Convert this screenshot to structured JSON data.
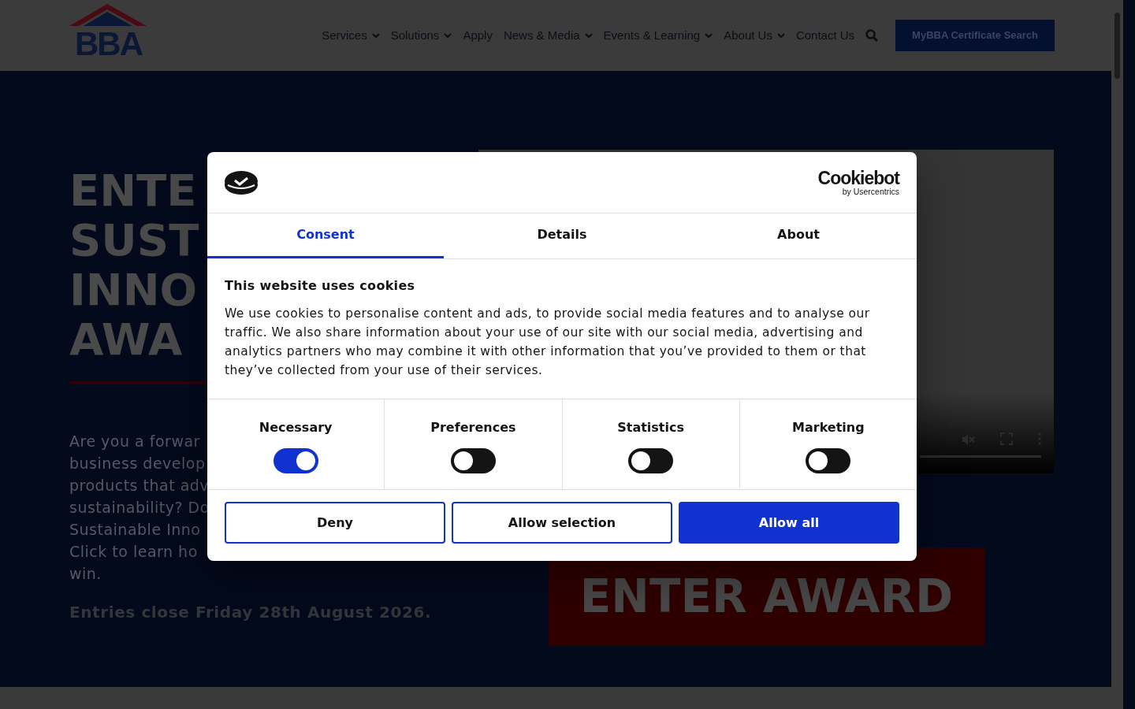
{
  "header": {
    "logo": "BBA",
    "nav": [
      {
        "label": "Services",
        "dropdown": true
      },
      {
        "label": "Solutions",
        "dropdown": true
      },
      {
        "label": "Apply",
        "dropdown": false
      },
      {
        "label": "News & Media",
        "dropdown": true
      },
      {
        "label": "Events & Learning",
        "dropdown": true
      },
      {
        "label": "About Us",
        "dropdown": true
      },
      {
        "label": "Contact Us",
        "dropdown": false
      }
    ],
    "cta": "MyBBA Certificate Search"
  },
  "hero": {
    "heading_lines": [
      "ENTE",
      "SUST",
      "INNO",
      "AWA"
    ],
    "intro_lines": [
      "Are you a forwar",
      "business develop",
      "products that adv",
      "sustainability? Do",
      "Sustainable Inno",
      "Click to learn ho",
      "win."
    ],
    "deadline": "Entries close Friday 28th August 2026.",
    "enter_button": "ENTER AWARD"
  },
  "cookie_dialog": {
    "brand": "Cookiebot",
    "brand_sub": "by Usercentrics",
    "tabs": [
      {
        "label": "Consent",
        "selected": true
      },
      {
        "label": "Details",
        "selected": false
      },
      {
        "label": "About",
        "selected": false
      }
    ],
    "title": "This website uses cookies",
    "body": "We use cookies to personalise content and ads, to provide social media features and to analyse our traffic. We also share information about your use of our site with our social media, advertising and analytics partners who may combine it with other information that you’ve provided to them or that they’ve collected from your use of their services.",
    "categories": [
      {
        "label": "Necessary",
        "checked": true
      },
      {
        "label": "Preferences",
        "checked": false
      },
      {
        "label": "Statistics",
        "checked": false
      },
      {
        "label": "Marketing",
        "checked": false
      }
    ],
    "buttons": [
      {
        "label": "Deny",
        "kind": "outline"
      },
      {
        "label": "Allow selection",
        "kind": "outline"
      },
      {
        "label": "Allow all",
        "kind": "primary"
      }
    ]
  }
}
